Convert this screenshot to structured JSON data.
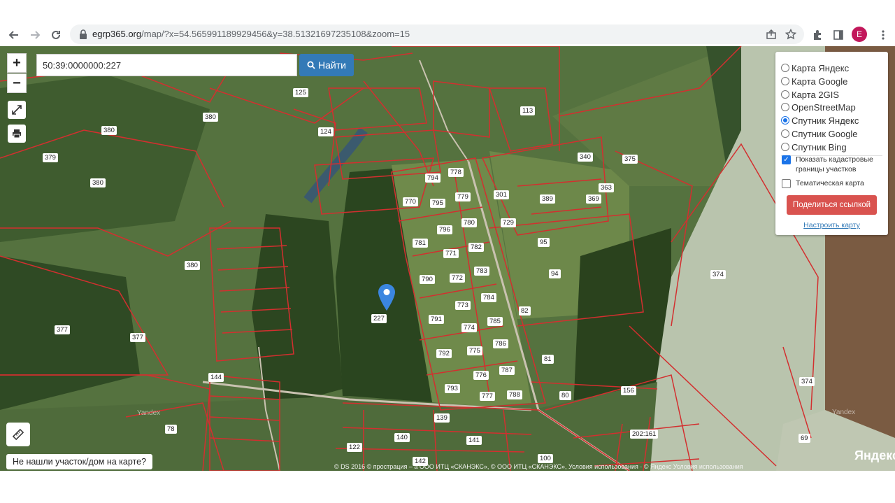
{
  "browser": {
    "url_host": "egrp365.org",
    "url_rest": "/map/?x=54.565991189929456&y=38.51321697235108&zoom=15",
    "profile_initial": "E",
    "profile_color": "#c2185b"
  },
  "map": {
    "search_value": "50:39:0000000:227",
    "search_button": "Найти",
    "zoom_in": "+",
    "zoom_out": "−",
    "not_found_link": "Не нашли участок/дом на карте?",
    "attribution": "© DS 2016 © прострация – a ООО ИТЦ «СКАНЭКС», © ООО ИТЦ «СКАНЭКС», Условия использования · © Яндекс Условия использования",
    "yandex_logo": "Яндекс",
    "watermark": "Yandex",
    "marker_color": "#3b86e0",
    "parcel_border_color": "#d32f2f"
  },
  "layers": {
    "options": [
      {
        "label": "Карта Яндекс",
        "selected": false
      },
      {
        "label": "Карта Google",
        "selected": false
      },
      {
        "label": "Карта 2GIS",
        "selected": false
      },
      {
        "label": "OpenStreetMap",
        "selected": false
      },
      {
        "label": "Спутник Яндекс",
        "selected": true
      },
      {
        "label": "Спутник Google",
        "selected": false
      },
      {
        "label": "Спутник Bing",
        "selected": false
      }
    ],
    "show_cadastral": {
      "label": "Показать кадастровые границы участков",
      "checked": true
    },
    "thematic_map": {
      "label": "Тематическая карта",
      "checked": false
    },
    "share_button": "Поделиться ссылкой",
    "configure_link": "Настроить карту"
  },
  "parcels": [
    "380",
    "380",
    "380",
    "380",
    "379",
    "377",
    "377",
    "125",
    "124",
    "113",
    "340",
    "375",
    "363",
    "369",
    "389",
    "301",
    "729",
    "95",
    "94",
    "82",
    "81",
    "80",
    "156",
    "374",
    "374",
    "202:161",
    "69",
    "770",
    "794",
    "778",
    "795",
    "779",
    "796",
    "780",
    "781",
    "771",
    "782",
    "790",
    "772",
    "783",
    "791",
    "773",
    "784",
    "774",
    "785",
    "792",
    "775",
    "786",
    "776",
    "787",
    "793",
    "777",
    "788",
    "227",
    "139",
    "140",
    "141",
    "142",
    "100",
    "122",
    "144",
    "78"
  ]
}
